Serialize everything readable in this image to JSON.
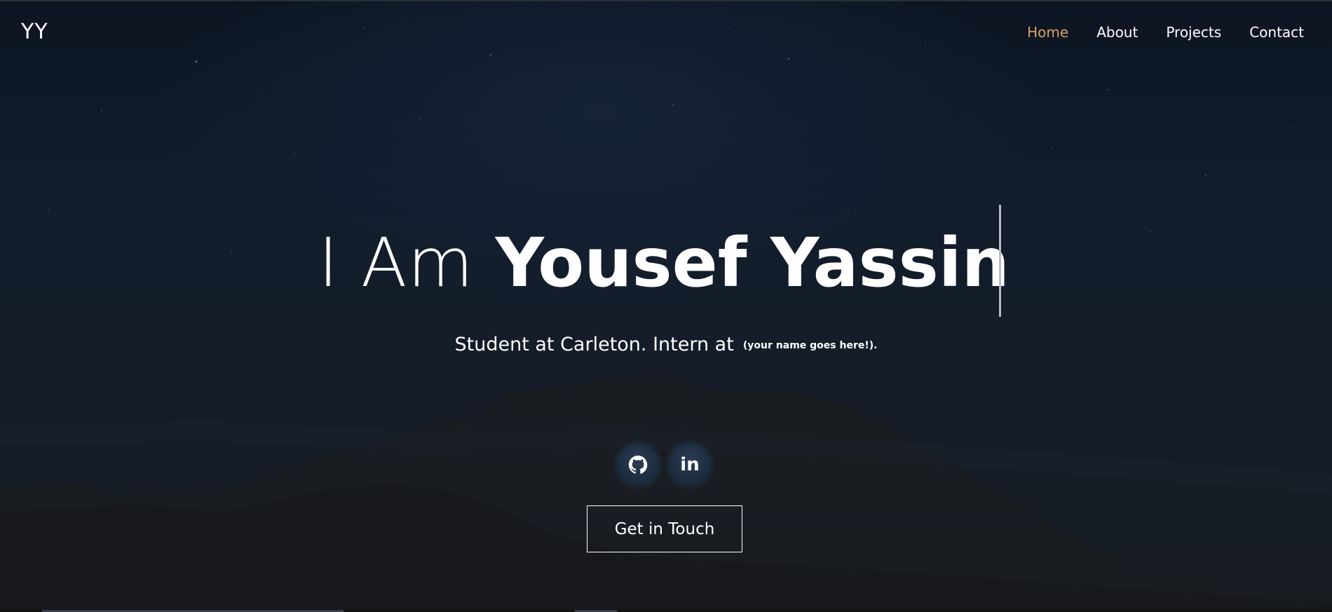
{
  "brand": {
    "logo": "YY"
  },
  "nav": {
    "items": [
      {
        "label": "Home",
        "active": true
      },
      {
        "label": "About",
        "active": false
      },
      {
        "label": "Projects",
        "active": false
      },
      {
        "label": "Contact",
        "active": false
      }
    ]
  },
  "hero": {
    "headline_prefix": "I Am",
    "headline_name": "Yousef Yassin",
    "subtitle": "Student at Carleton. Intern at",
    "subtitle_small": "(your name goes here!)."
  },
  "socials": [
    {
      "icon": "github-icon"
    },
    {
      "icon": "linkedin-icon",
      "glyph": "in"
    }
  ],
  "cta": {
    "label": "Get in Touch"
  },
  "colors": {
    "accent": "#d9a066",
    "text": "#ffffff",
    "background": "#0e1622"
  }
}
